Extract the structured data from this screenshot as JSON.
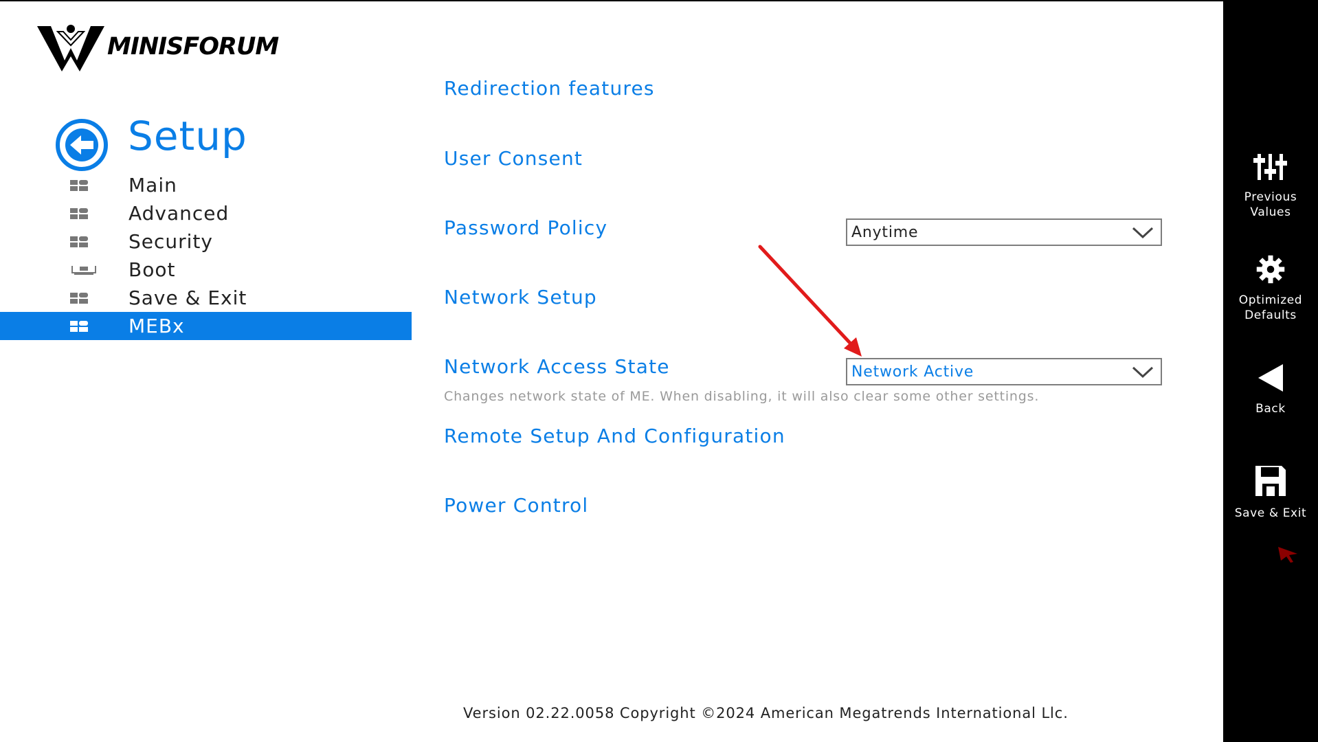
{
  "brand": {
    "name": "MINISFORUM"
  },
  "setup": {
    "title": "Setup"
  },
  "nav": {
    "items": [
      {
        "label": "Main"
      },
      {
        "label": "Advanced"
      },
      {
        "label": "Security"
      },
      {
        "label": "Boot"
      },
      {
        "label": "Save & Exit"
      },
      {
        "label": "MEBx"
      }
    ],
    "active_index": 5
  },
  "menu": {
    "redirection": "Redirection features",
    "user_consent": "User Consent",
    "password_policy": "Password Policy",
    "password_policy_value": "Anytime",
    "network_setup": "Network Setup",
    "network_access_state": "Network Access State",
    "network_access_state_value": "Network Active",
    "network_access_help": "Changes network state of ME. When disabling, it will also clear some other settings.",
    "remote_setup": "Remote Setup And Configuration",
    "power_control": "Power Control"
  },
  "footer": {
    "text": "Version 02.22.0058 Copyright ©2024 American Megatrends International Llc."
  },
  "actions": {
    "previous_values": {
      "line1": "Previous",
      "line2": "Values",
      "icon": "sliders-icon"
    },
    "optimized_defaults": {
      "line1": "Optimized",
      "line2": "Defaults",
      "icon": "gear-icon"
    },
    "back": {
      "label": "Back",
      "icon": "back-triangle-icon"
    },
    "save_exit": {
      "label": "Save & Exit",
      "icon": "floppy-disk-icon"
    }
  },
  "colors": {
    "accent": "#0a7ee6",
    "annotation": "#e11b1b",
    "sidebar": "#000000"
  }
}
